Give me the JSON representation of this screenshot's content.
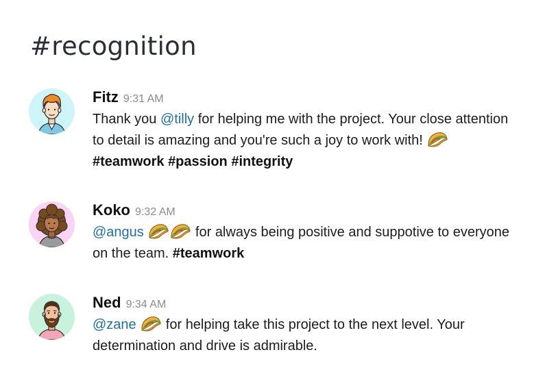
{
  "channel": {
    "title": "#recognition"
  },
  "messages": [
    {
      "author": "Fitz",
      "time": "9:31 AM",
      "mention": "@tilly",
      "text_1": " for helping me with the project. Your close attention to detail is amazing and you're such a joy to work with! ",
      "prefix": "Thank you ",
      "hashtags": [
        "#teamwork",
        "#passion",
        "#integrity"
      ],
      "avatar_icon": "man-orange-hair-avatar",
      "avatar_bg": "#cff5f8"
    },
    {
      "author": "Koko",
      "time": "9:32 AM",
      "mention": "@angus",
      "text_1": " for always being positive and suppotive to everyone on the team. ",
      "hashtags": [
        "#teamwork"
      ],
      "avatar_icon": "woman-curly-hair-avatar",
      "avatar_bg": "#fbd3f3"
    },
    {
      "author": "Ned",
      "time": "9:34 AM",
      "mention": "@zane",
      "text_1": " for helping take this project to the next level. Your determination and drive is admirable.",
      "hashtags": [],
      "avatar_icon": "bearded-man-avatar",
      "avatar_bg": "#c8f2dc"
    }
  ],
  "icons": {
    "taco": "taco-emoji"
  },
  "colors": {
    "mention": "#1f6fa6",
    "timestamp": "#8a8a8a",
    "title": "#2a2f36"
  }
}
